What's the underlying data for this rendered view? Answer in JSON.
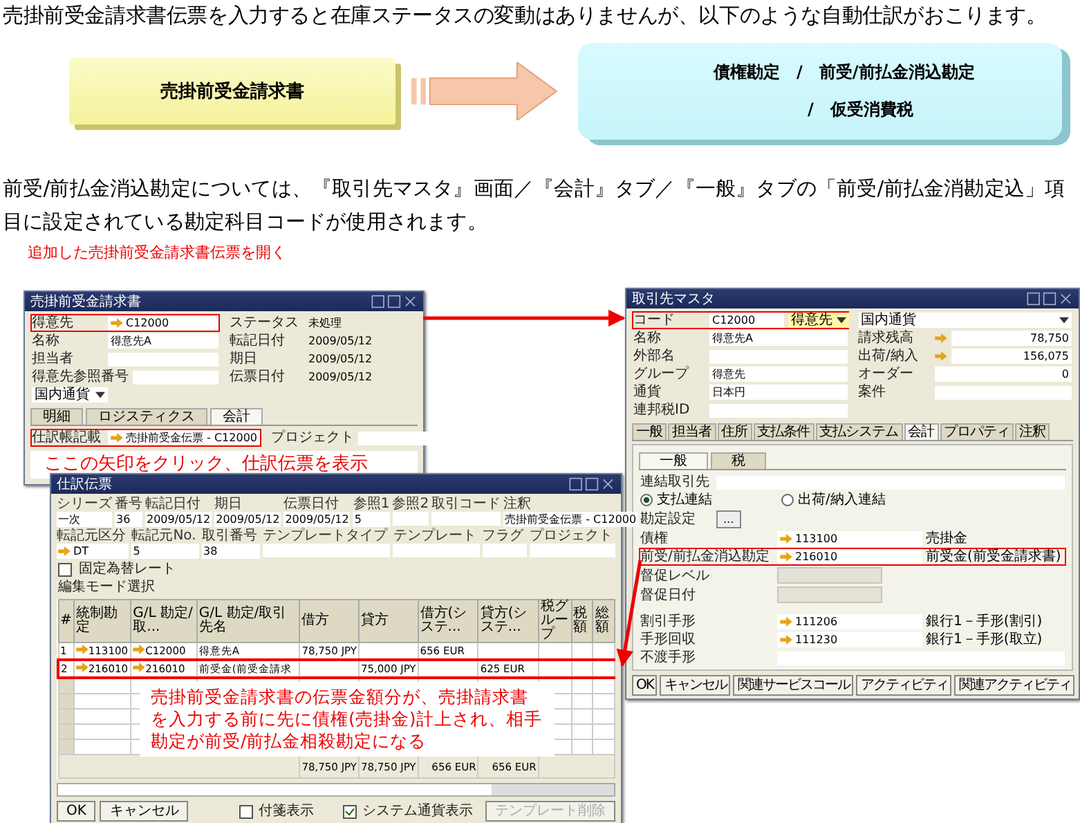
{
  "intro": "売掛前受金請求書伝票を入力すると在庫ステータスの変動はありませんが、以下のような自動仕訳がおこります。",
  "flow": {
    "source": "売掛前受金請求書",
    "result_lines": [
      "債権勘定　/　前受/前払金消込勘定",
      "/　仮受消費税"
    ]
  },
  "note": "前受/前払金消込勘定については、『取引先マスタ』画面／『会計』タブ／『一般』タブの「前受/前払金消勘定込」項目に設定されている勘定科目コードが使用されます。",
  "caption": "追加した売掛前受金請求書伝票を開く",
  "invoice_window": {
    "title": "売掛前受金請求書",
    "left_fields": [
      {
        "label": "得意先",
        "value": "C12000",
        "link": true,
        "highlighted": true
      },
      {
        "label": "名称",
        "value": "得意先A",
        "link": false,
        "highlighted": false
      },
      {
        "label": "担当者",
        "link": false,
        "highlighted": false
      },
      {
        "label": "得意先参照番号",
        "link": false,
        "highlighted": false
      }
    ],
    "currency_select": "国内通貨",
    "right_fields": [
      {
        "label": "ステータス",
        "value": "未処理"
      },
      {
        "label": "転記日付",
        "value": "2009/05/12"
      },
      {
        "label": "期日",
        "value": "2009/05/12"
      },
      {
        "label": "伝票日付",
        "value": "2009/05/12"
      }
    ],
    "tabs": [
      {
        "label": "明細",
        "selected": false
      },
      {
        "label": "ロジスティクス",
        "selected": false
      },
      {
        "label": "会計",
        "selected": true
      }
    ],
    "journal_field": {
      "label": "仕訳帳記載",
      "value": "売掛前受金伝票 - C12000",
      "highlighted": true
    },
    "project_label": "プロジェクト",
    "callout": "ここの矢印をクリック、仕訳伝票を表示"
  },
  "bp_window": {
    "title": "取引先マスタ",
    "left_fields": [
      {
        "label": "コード",
        "value": "C12000",
        "extra": "得意先",
        "highlighted": true
      },
      {
        "label": "名称",
        "value": "得意先A",
        "highlighted": false
      },
      {
        "label": "外部名",
        "highlighted": false
      },
      {
        "label": "グループ",
        "value": "得意先",
        "highlighted": false
      },
      {
        "label": "通貨",
        "value": "日本円",
        "highlighted": false
      },
      {
        "label": "連邦税ID",
        "highlighted": false
      }
    ],
    "currency_select": "国内通貨",
    "right_fields": [
      {
        "label": "請求残高",
        "value": "78,750",
        "link": true
      },
      {
        "label": "出荷/納入",
        "value": "156,075",
        "link": true
      },
      {
        "label": "オーダー",
        "value": "0",
        "link": false
      },
      {
        "label": "案件",
        "link": false
      }
    ],
    "tabs": [
      {
        "label": "一般",
        "selected": false
      },
      {
        "label": "担当者",
        "selected": false
      },
      {
        "label": "住所",
        "selected": false
      },
      {
        "label": "支払条件",
        "selected": false
      },
      {
        "label": "支払システム",
        "selected": false
      },
      {
        "label": "会計",
        "selected": true
      },
      {
        "label": "プロパティ",
        "selected": false
      },
      {
        "label": "注釈",
        "selected": false
      }
    ],
    "subtabs": [
      {
        "label": "一般",
        "selected": true
      },
      {
        "label": "税",
        "selected": false
      }
    ],
    "consolidation_label": "連結取引先",
    "radios": [
      {
        "label": "支払連結",
        "selected": true
      },
      {
        "label": "出荷/納入連結",
        "selected": false
      }
    ],
    "account_settings_label": "勘定設定",
    "account_settings_button": "...",
    "accounts": [
      {
        "label": "債権",
        "code": "113100",
        "name": "売掛金",
        "highlighted": false
      },
      {
        "label": "前受/前払金消込勘定",
        "code": "216010",
        "name": "前受金(前受金請求書)",
        "highlighted": true
      }
    ],
    "dunning": [
      "督促レベル",
      "督促日付"
    ],
    "bills": [
      {
        "label": "割引手形",
        "code": "111206",
        "name": "銀行1－手形(割引)"
      },
      {
        "label": "手形回収",
        "code": "111230",
        "name": "銀行1－手形(取立)"
      },
      {
        "label": "不渡手形"
      }
    ],
    "buttons": [
      "OK",
      "キャンセル",
      "関連サービスコール",
      "アクティビティ",
      "関連アクティビティ"
    ]
  },
  "journal_window": {
    "title": "仕訳伝票",
    "header_row_1": [
      {
        "label": "シリーズ",
        "value": "一次"
      },
      {
        "label": "番号",
        "value": "36"
      },
      {
        "label": "転記日付",
        "value": "2009/05/12"
      },
      {
        "label": "期日",
        "value": "2009/05/12"
      },
      {
        "label": "伝票日付",
        "value": "2009/05/12"
      },
      {
        "label": "参照1",
        "value": "5"
      },
      {
        "label": "参照2"
      },
      {
        "label": "取引コード"
      },
      {
        "label": "注釈",
        "value": "売掛前受金伝票 - C12000"
      }
    ],
    "header_row_2": [
      {
        "label": "転記元区分",
        "value": "DT",
        "link": true
      },
      {
        "label": "転記元No.",
        "value": "5"
      },
      {
        "label": "取引番号",
        "value": "38"
      },
      {
        "label": "テンプレートタイプ"
      },
      {
        "label": "テンプレート"
      },
      {
        "label": "フラグ"
      },
      {
        "label": "プロジェクト"
      }
    ],
    "fixed_rate": {
      "label": "固定為替レート",
      "checked": false
    },
    "mode_label": "編集モード選択",
    "columns": [
      "#",
      "統制勘定",
      "G/L 勘定/取...",
      "G/L 勘定/取引先名",
      "借方",
      "貸方",
      "借方(システ...",
      "貸方(システ...",
      "税グループ",
      "税額",
      "総額"
    ],
    "rows": [
      {
        "cells": [
          "1",
          "113100",
          "C12000",
          "得意先A",
          "78,750 JPY",
          "",
          "656 EUR",
          "",
          "",
          "",
          ""
        ],
        "highlighted": false
      },
      {
        "cells": [
          "2",
          "216010",
          "216010",
          "前受金(前受金請求",
          "",
          "75,000 JPY",
          "",
          "625 EUR",
          "",
          "",
          ""
        ],
        "highlighted": true
      }
    ],
    "totals": [
      "78,750 JPY",
      "78,750 JPY",
      "656 EUR",
      "656 EUR"
    ],
    "callout": "売掛前受金請求書の伝票金額分が、売掛請求書を入力する前に先に債権(売掛金)計上され、相手勘定が前受/前払金相殺勘定になる",
    "buttons": [
      "OK",
      "キャンセル"
    ],
    "options": [
      {
        "label": "付箋表示",
        "checked": false
      },
      {
        "label": "システム通貨表示",
        "checked": true
      }
    ],
    "template_button": {
      "label": "テンプレート削除",
      "disabled": true
    }
  }
}
